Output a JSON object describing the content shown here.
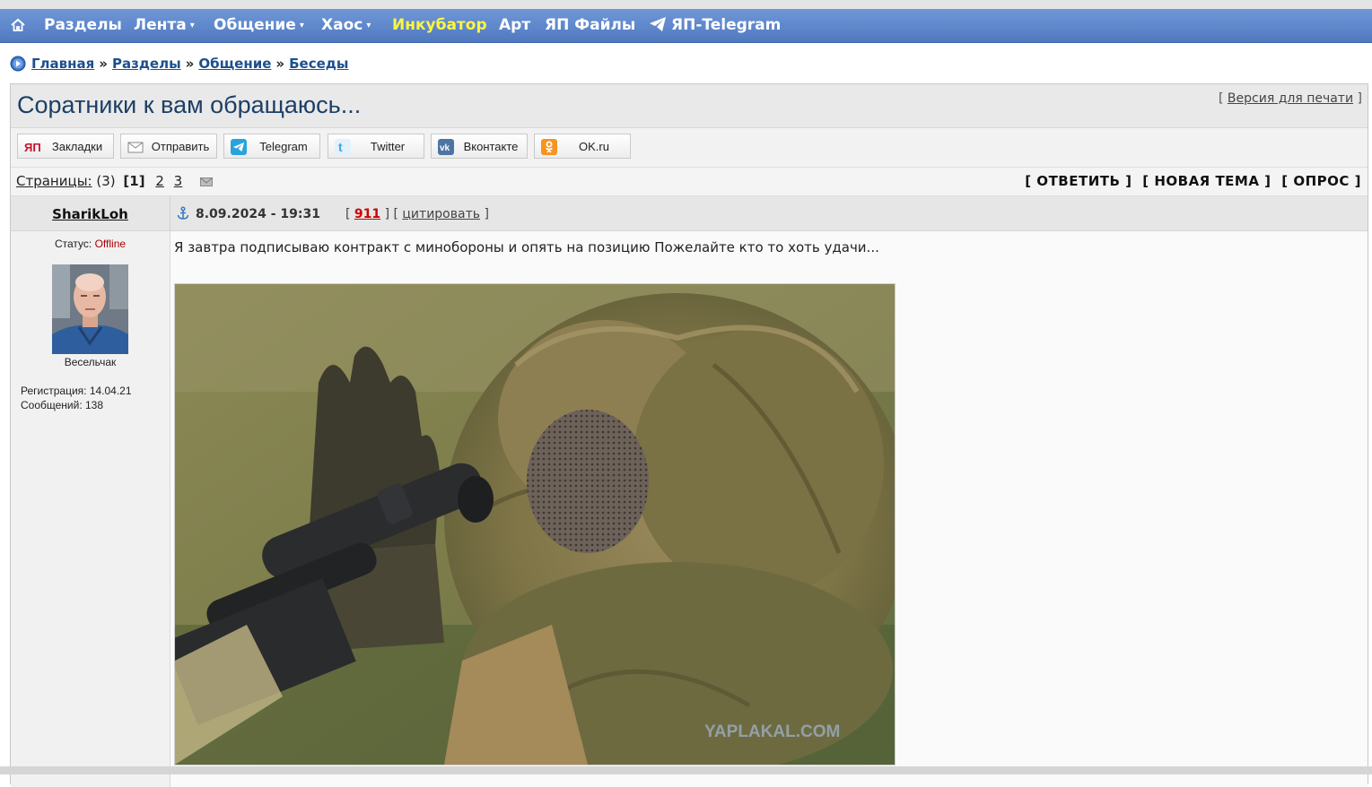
{
  "nav": {
    "home_icon": "home-icon",
    "items": [
      {
        "label": "Разделы",
        "dropdown": false
      },
      {
        "label": "Лента",
        "dropdown": true
      },
      {
        "label": "Общение",
        "dropdown": true
      },
      {
        "label": "Хаос",
        "dropdown": true
      },
      {
        "label": "Инкубатор",
        "dropdown": false,
        "highlight": "#fff640"
      },
      {
        "label": "Арт",
        "dropdown": false
      },
      {
        "label": "ЯП Файлы",
        "dropdown": false
      },
      {
        "label": "ЯП-Telegram",
        "dropdown": false,
        "icon": "telegram-icon"
      }
    ],
    "caret": "▾",
    "bg_color": "#5e87cc"
  },
  "breadcrumb": {
    "icon": "circle-arrow-icon",
    "items": [
      "Главная",
      "Разделы",
      "Общение",
      "Беседы"
    ],
    "separator": "»"
  },
  "topic": {
    "title": "Соратники к вам обращаюсь...",
    "print_open": "[",
    "print_label": "Версия для печати",
    "print_close": "]"
  },
  "share": [
    {
      "label": "Закладки",
      "icon": "yap-icon"
    },
    {
      "label": "Отправить",
      "icon": "envelope-icon"
    },
    {
      "label": "Telegram",
      "icon": "telegram-icon"
    },
    {
      "label": "Twitter",
      "icon": "twitter-icon"
    },
    {
      "label": "Вконтакте",
      "icon": "vk-icon"
    },
    {
      "label": "OK.ru",
      "icon": "ok-icon"
    }
  ],
  "pagination": {
    "label": "Страницы:",
    "count": "(3)",
    "current": "[1]",
    "pages": [
      "2",
      "3"
    ],
    "subscribe_icon": "envelope-icon"
  },
  "actions": [
    "[ ОТВЕТИТЬ ]",
    "[ НОВАЯ ТЕМА ]",
    "[ ОПРОС ]"
  ],
  "post": {
    "author": "SharikLoh",
    "status_label": "Статус:",
    "status_value": "Offline",
    "rank": "Весельчак",
    "registration": "Регистрация: 14.04.21",
    "messages": "Сообщений: 138",
    "anchor_icon": "anchor-icon",
    "date": "8.09.2024 - 19:31",
    "number_open": "[",
    "number": "911",
    "number_close": "]",
    "quote_open": "[",
    "quote_label": "цитировать",
    "quote_close": "]",
    "text": "Я завтра подписываю контракт с минобороны и опять на позицию Пожелайте кто то хоть удачи...",
    "image_watermark": "YAPLAKAL.COM"
  }
}
